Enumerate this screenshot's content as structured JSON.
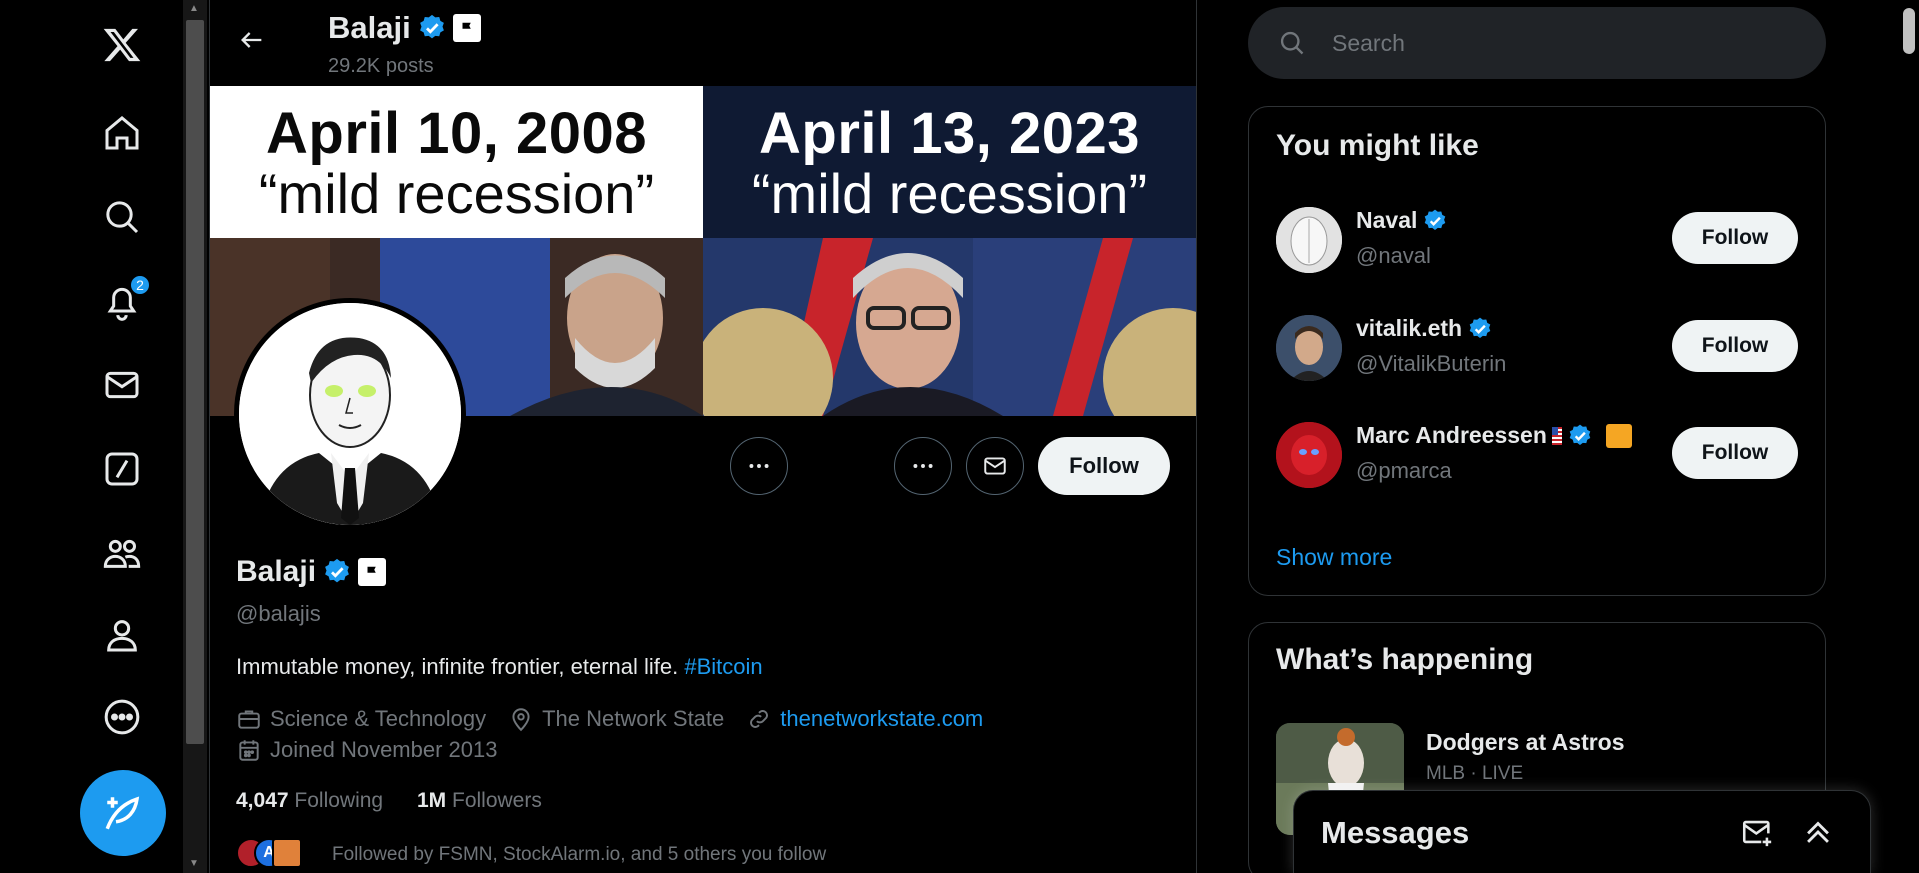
{
  "nav": {
    "items": [
      "x-logo-icon",
      "home-icon",
      "explore-icon",
      "notifications-icon",
      "messages-icon",
      "grok-icon",
      "communities-icon",
      "profile-icon",
      "more-icon"
    ],
    "notifications_count": "2",
    "post_icon": "compose-post-icon"
  },
  "topbar": {
    "name": "Balaji",
    "posts": "29.2K posts"
  },
  "banner": {
    "left_date": "April 10, 2008",
    "left_quote": "“mild recession”",
    "right_date": "April 13, 2023",
    "right_quote": "“mild recession”"
  },
  "profile": {
    "name": "Balaji",
    "handle": "@balajis",
    "bio_text": "Immutable money, infinite frontier, eternal life.",
    "bio_hashtag": "#Bitcoin",
    "category": "Science & Technology",
    "location": "The Network State",
    "website": "thenetworkstate.com",
    "joined": "Joined November 2013",
    "following_count": "4,047",
    "following_label": "Following",
    "followers_count": "1M",
    "followers_label": "Followers",
    "followed_by": "Followed by FSMN, StockAlarm.io, and 5 others you follow",
    "follow_label": "Follow"
  },
  "search": {
    "placeholder": "Search"
  },
  "you_might_like": {
    "title": "You might like",
    "users": [
      {
        "name": "Naval",
        "handle": "@naval",
        "button": "Follow"
      },
      {
        "name": "vitalik.eth",
        "handle": "@VitalikButerin",
        "button": "Follow"
      },
      {
        "name": "Marc Andreessen",
        "handle": "@pmarca",
        "button": "Follow"
      }
    ],
    "show_more": "Show more"
  },
  "whats_happening": {
    "title": "What’s happening",
    "trend_title": "Dodgers at Astros",
    "trend_sub": "MLB · LIVE"
  },
  "messages": {
    "title": "Messages"
  },
  "colors": {
    "accent": "#1d9bf0",
    "background": "#000000",
    "text": "#e7e9ea",
    "muted": "#71767b"
  }
}
